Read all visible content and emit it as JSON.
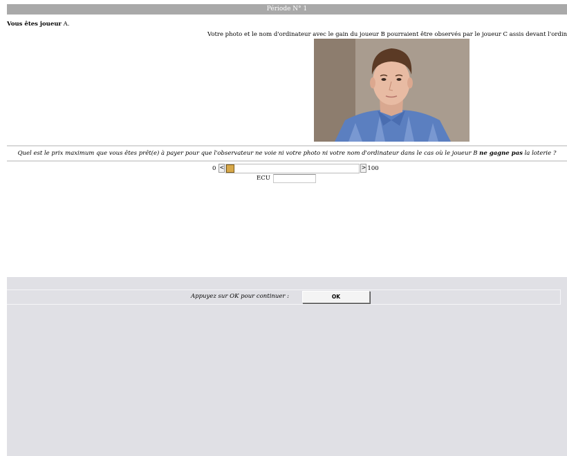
{
  "header": {
    "period_title": "Période N° 1"
  },
  "player": {
    "label_bold": "Vous êtes joueur",
    "label_rest": " A."
  },
  "notice": {
    "text": "Votre photo et le nom d'ordinateur avec le gain du joueur B pourraient être observés par le joueur C assis devant l'ordinateur DUBLIN"
  },
  "question": {
    "text_before": "Quel est le prix maximum que vous êtes prêt(e) à payer pour que l'observateur ne voie ni votre photo ni votre nom d'ordinateur dans le cas où le joueur B ",
    "text_bold": "ne gagne pas",
    "text_after": " la loterie ?"
  },
  "slider": {
    "min_label": "0",
    "max_label": "100",
    "left_arrow": "<",
    "right_arrow": ">",
    "value": 0,
    "min": 0,
    "max": 100
  },
  "ecu": {
    "label": "ECU",
    "value": ""
  },
  "footer": {
    "continue_label": "Appuyez sur OK pour continuer :",
    "ok_label": "OK"
  },
  "colors": {
    "header_bar": "#a9a9a9",
    "slider_thumb": "#d7a84a",
    "footer_bg": "#e0e0e5"
  }
}
